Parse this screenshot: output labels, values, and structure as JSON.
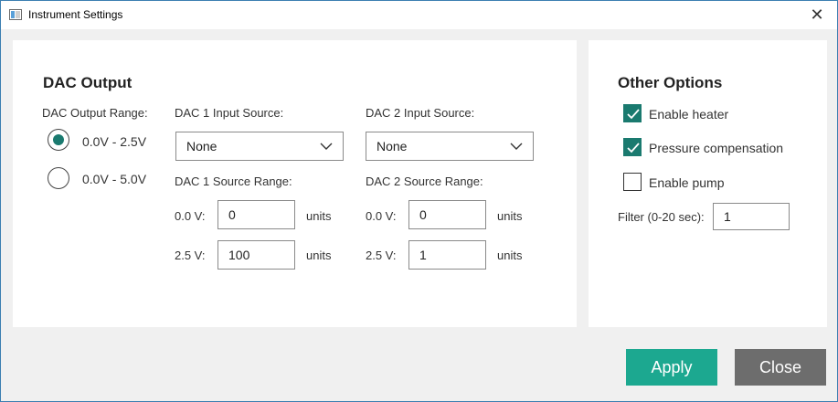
{
  "window": {
    "title": "Instrument Settings",
    "close_glyph": "✕"
  },
  "dac": {
    "heading": "DAC Output",
    "range_label": "DAC Output Range:",
    "range_options": [
      "0.0V - 2.5V",
      "0.0V - 5.0V"
    ],
    "range_selected": "0.0V - 2.5V",
    "dac1": {
      "input_source_label": "DAC 1 Input Source:",
      "input_source_value": "None",
      "source_range_label": "DAC 1 Source Range:",
      "low_label": "0.0 V:",
      "low_value": "0",
      "high_label": "2.5 V:",
      "high_value": "100",
      "units": "units"
    },
    "dac2": {
      "input_source_label": "DAC 2 Input Source:",
      "input_source_value": "None",
      "source_range_label": "DAC 2 Source Range:",
      "low_label": "0.0 V:",
      "low_value": "0",
      "high_label": "2.5 V:",
      "high_value": "1",
      "units": "units"
    }
  },
  "other": {
    "heading": "Other Options",
    "enable_heater": {
      "label": "Enable heater",
      "checked": true
    },
    "pressure_comp": {
      "label": "Pressure compensation",
      "checked": true
    },
    "enable_pump": {
      "label": "Enable pump",
      "checked": false
    },
    "filter_label": "Filter (0-20 sec):",
    "filter_value": "1"
  },
  "buttons": {
    "apply": "Apply",
    "close": "Close"
  },
  "colors": {
    "accent": "#1a7a6f",
    "apply_bg": "#1ca890",
    "close_bg": "#6d6d6d"
  }
}
